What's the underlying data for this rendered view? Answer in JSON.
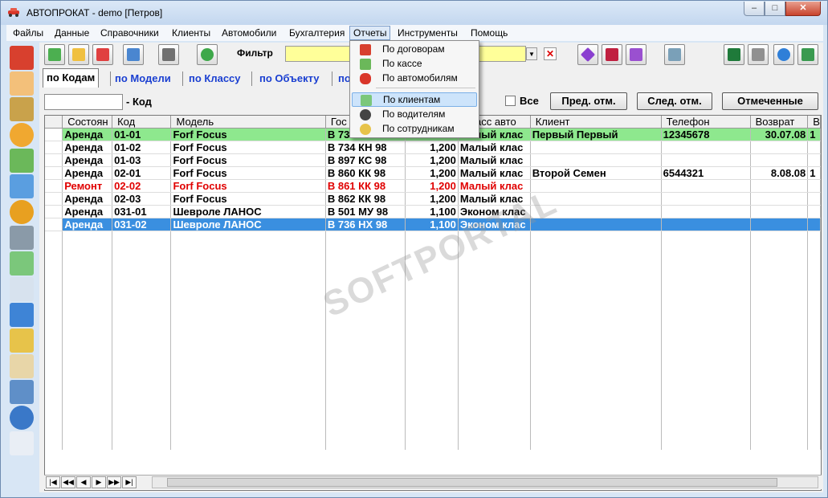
{
  "window": {
    "title": "АВТОПРОКАТ - demo  [Петров]",
    "controls": {
      "minimize": "–",
      "maximize": "□",
      "close": "✕"
    }
  },
  "menu": [
    "Файлы",
    "Данные",
    "Справочники",
    "Клиенты",
    "Автомобили",
    "Бухгалтерия",
    "Отчеты",
    "Инструменты",
    "Помощь"
  ],
  "toolbar": {
    "filter_label": "Фильтр",
    "filter_value": ""
  },
  "tabs": [
    "по Кодам",
    "по Модели",
    "по Классу",
    "по Объекту",
    "по"
  ],
  "code_label": "- Код",
  "all_label": "Все",
  "buttons": {
    "prev": "Пред. отм.",
    "next": "След. отм.",
    "marked": "Отмеченные"
  },
  "grid": {
    "columns": [
      "Состоян",
      "Код",
      "Модель",
      "Гос",
      "",
      "Класс авто",
      "Клиент",
      "Телефон",
      "Возврат",
      "В"
    ],
    "rows": [
      [
        "Аренда",
        "01-01",
        "Forf Focus",
        "В 73",
        "",
        "Малый клас",
        "Первый Первый",
        "12345678",
        "30.07.08",
        "1"
      ],
      [
        "Аренда",
        "01-02",
        "Forf Focus",
        "В 734 КН 98",
        "1,200",
        "Малый клас",
        "",
        "",
        "",
        ""
      ],
      [
        "Аренда",
        "01-03",
        "Forf Focus",
        "В 897 КС 98",
        "1,200",
        "Малый клас",
        "",
        "",
        "",
        ""
      ],
      [
        "Аренда",
        "02-01",
        "Forf Focus",
        "В 860 КК 98",
        "1,200",
        "Малый клас",
        "Второй Семен",
        "6544321",
        "8.08.08",
        "1"
      ],
      [
        "Ремонт",
        "02-02",
        "Forf Focus",
        "В 861 КК 98",
        "1,200",
        "Малый клас",
        "",
        "",
        "",
        ""
      ],
      [
        "Аренда",
        "02-03",
        "Forf Focus",
        "В 862 КК 98",
        "1,200",
        "Малый клас",
        "",
        "",
        "",
        ""
      ],
      [
        "Аренда",
        "031-01",
        "Шевроле ЛАНОС",
        "В 501 МУ 98",
        "1,100",
        "Эконом клас",
        "",
        "",
        "",
        ""
      ],
      [
        "Аренда",
        "031-02",
        "Шевроле ЛАНОС",
        "В 736 НХ 98",
        "1,100",
        "Эконом клас",
        "",
        "",
        "",
        ""
      ]
    ]
  },
  "nav": [
    "|◀",
    "◀◀",
    "◀",
    "▶",
    "▶▶",
    "▶|"
  ],
  "reports_menu": [
    "По договорам",
    "По кассе",
    "По автомобилям",
    "По клиентам",
    "По водителям",
    "По сотрудникам"
  ],
  "watermark": "SOFTPORTAL"
}
